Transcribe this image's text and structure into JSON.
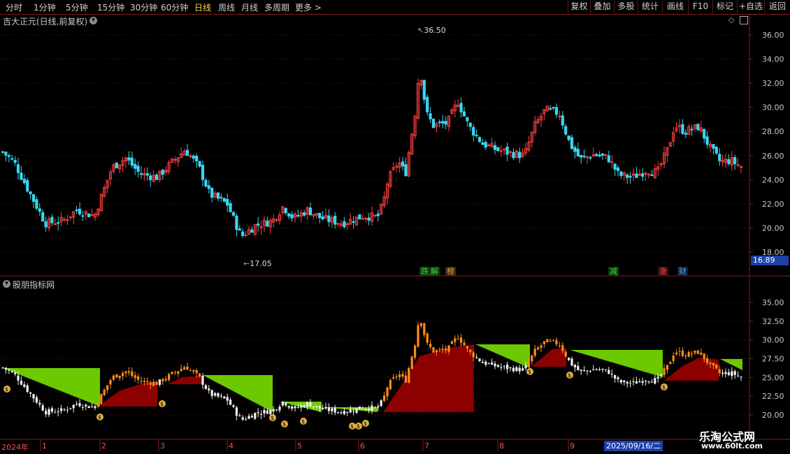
{
  "toolbar": {
    "periods": [
      "分时",
      "1分钟",
      "5分钟",
      "15分钟",
      "30分钟",
      "60分钟",
      "日线",
      "周线",
      "月线",
      "多周期",
      "更多 >"
    ],
    "active_period": "日线",
    "right_buttons": [
      "复权",
      "叠加",
      "多股",
      "统计",
      "画线",
      "F10",
      "标记",
      "+自选",
      "返回"
    ]
  },
  "main_panel": {
    "title": "吉大正元(日线,前复权)",
    "high_label": "36.50",
    "low_label": "17.05",
    "current_price_box": "16.89",
    "price_ticks": [
      "36.00",
      "34.00",
      "32.00",
      "30.00",
      "28.00",
      "26.00",
      "24.00",
      "22.00",
      "20.00",
      "18.00"
    ],
    "event_tags": [
      {
        "text": "跌",
        "color": "#3fd24a"
      },
      {
        "text": "解",
        "color": "#3fd24a"
      },
      {
        "text": "榜",
        "color": "#e0a040"
      },
      {
        "text": "减",
        "color": "#3fd24a"
      },
      {
        "text": "涨",
        "color": "#ff4b4b"
      },
      {
        "text": "财",
        "color": "#5aa0ff"
      }
    ]
  },
  "indicator_panel": {
    "title": "股朋指标网",
    "ticks": [
      "35.00",
      "32.50",
      "30.00",
      "27.50",
      "25.00",
      "22.50",
      "20.00"
    ],
    "signal_texts": [
      "卖出",
      "买入"
    ]
  },
  "time_axis": {
    "year_label": "2024年",
    "months": [
      "1",
      "2",
      "3",
      "4",
      "5",
      "6",
      "7",
      "8",
      "9"
    ],
    "cursor_date": "2025/09/16/二"
  },
  "watermark": {
    "name": "乐淘公式网",
    "url": "www.60lt.com"
  },
  "colors": {
    "up": "#ff4040",
    "down": "#38d6f0",
    "bull_fill": "#8c0000",
    "bear_fill": "#6cc800",
    "axis": "#8b1a1a"
  }
}
